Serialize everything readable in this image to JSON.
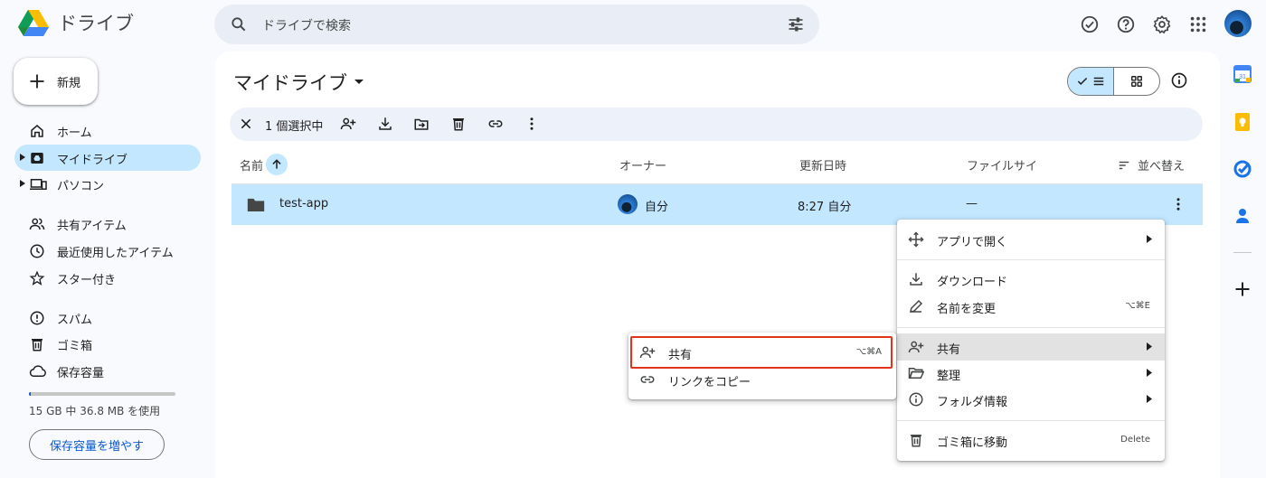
{
  "app": {
    "title": "ドライブ"
  },
  "search": {
    "placeholder": "ドライブで検索"
  },
  "sidebar": {
    "new_label": "新規",
    "items": [
      {
        "label": "ホーム"
      },
      {
        "label": "マイドライブ"
      },
      {
        "label": "パソコン"
      },
      {
        "label": "共有アイテム"
      },
      {
        "label": "最近使用したアイテム"
      },
      {
        "label": "スター付き"
      },
      {
        "label": "スパム"
      },
      {
        "label": "ゴミ箱"
      },
      {
        "label": "保存容量"
      }
    ],
    "storage_text": "15 GB 中 36.8 MB を使用",
    "storage_used_fraction": 0.0025,
    "storage_button": "保存容量を増やす"
  },
  "main": {
    "title": "マイドライブ",
    "selection_text": "1 個選択中",
    "columns": {
      "name": "名前",
      "owner": "オーナー",
      "modified": "更新日時",
      "size": "ファイルサイ",
      "sort": "並べ替え"
    },
    "rows": [
      {
        "name": "test-app",
        "owner": "自分",
        "modified": "8:27 自分",
        "size": "—"
      }
    ]
  },
  "context_menu": {
    "items": [
      {
        "label": "アプリで開く",
        "shortcut": ""
      },
      {
        "label": "ダウンロード",
        "shortcut": ""
      },
      {
        "label": "名前を変更",
        "shortcut": "⌥⌘E"
      },
      {
        "label": "共有",
        "shortcut": ""
      },
      {
        "label": "整理",
        "shortcut": ""
      },
      {
        "label": "フォルダ情報",
        "shortcut": ""
      },
      {
        "label": "ゴミ箱に移動",
        "shortcut": "Delete"
      }
    ]
  },
  "submenu": {
    "items": [
      {
        "label": "共有",
        "shortcut": "⌥⌘A"
      },
      {
        "label": "リンクをコピー",
        "shortcut": ""
      }
    ]
  },
  "colors": {
    "accent": "#0b57d0",
    "selected": "#c2e7ff",
    "highlight_box": "#e2331b"
  },
  "icons": [
    "drive-logo",
    "search-icon",
    "tune-icon",
    "offline-check-icon",
    "help-icon",
    "gear-icon",
    "apps-grid-icon"
  ]
}
